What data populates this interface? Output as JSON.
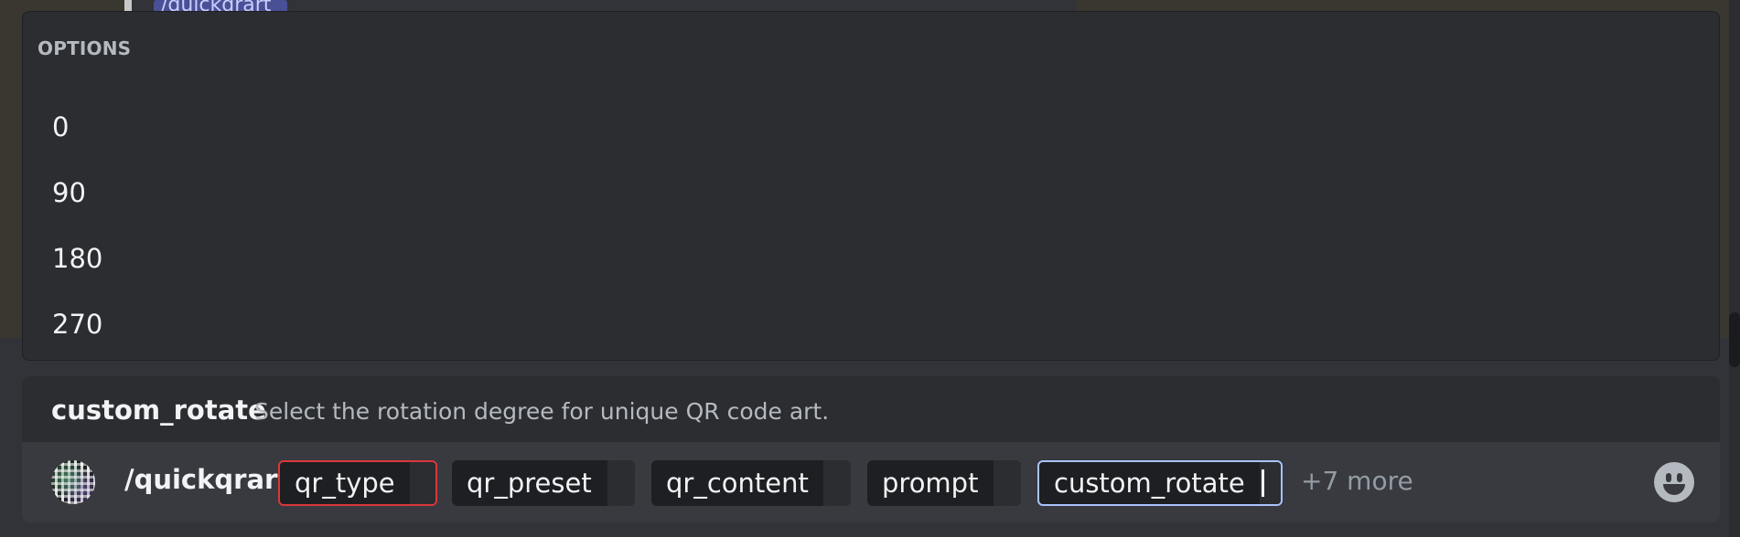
{
  "background": {
    "mention_text": "/quickqrart"
  },
  "popup": {
    "heading": "OPTIONS",
    "options": [
      "0",
      "90",
      "180",
      "270"
    ]
  },
  "description": {
    "option_name": "custom_rotate",
    "text": "Select the rotation degree for unique QR code art."
  },
  "command_bar": {
    "command": "/quickqrart",
    "chips": [
      {
        "name": "qr_type",
        "state": "error"
      },
      {
        "name": "qr_preset",
        "state": "default"
      },
      {
        "name": "qr_content",
        "state": "default"
      },
      {
        "name": "prompt",
        "state": "default"
      },
      {
        "name": "custom_rotate",
        "state": "active"
      }
    ],
    "more_label": "+7 more",
    "emoji_icon": "smile-emoji-icon",
    "avatar_icon": "qr-code-avatar"
  },
  "colors": {
    "background": "#313338",
    "popup_bg": "#2b2d31",
    "input_bg": "#383a40",
    "error_border": "#da373c",
    "active_border": "#a9c3ff"
  }
}
